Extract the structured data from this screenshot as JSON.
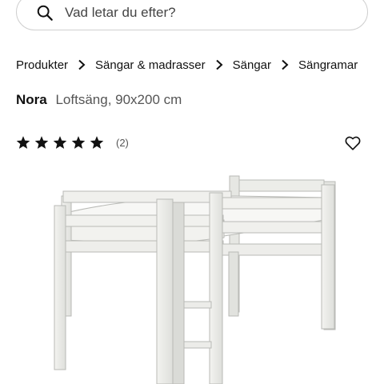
{
  "search": {
    "placeholder": "Vad letar du efter?",
    "icon": "search-icon"
  },
  "breadcrumb": {
    "items": [
      "Produkter",
      "Sängar & madrasser",
      "Sängar",
      "Sängramar"
    ],
    "separator_icon": "chevron-right-icon"
  },
  "product": {
    "name": "Nora",
    "description": "Loftsäng, 90x200 cm",
    "rating": {
      "stars": 5,
      "max": 5,
      "count_label": "(2)"
    },
    "favorite_icon": "heart-outline-icon",
    "image_alt": "white loft bed with ladder"
  },
  "colors": {
    "text": "#111111",
    "muted": "#555555",
    "border": "#cfcfcf",
    "background": "#ffffff"
  }
}
